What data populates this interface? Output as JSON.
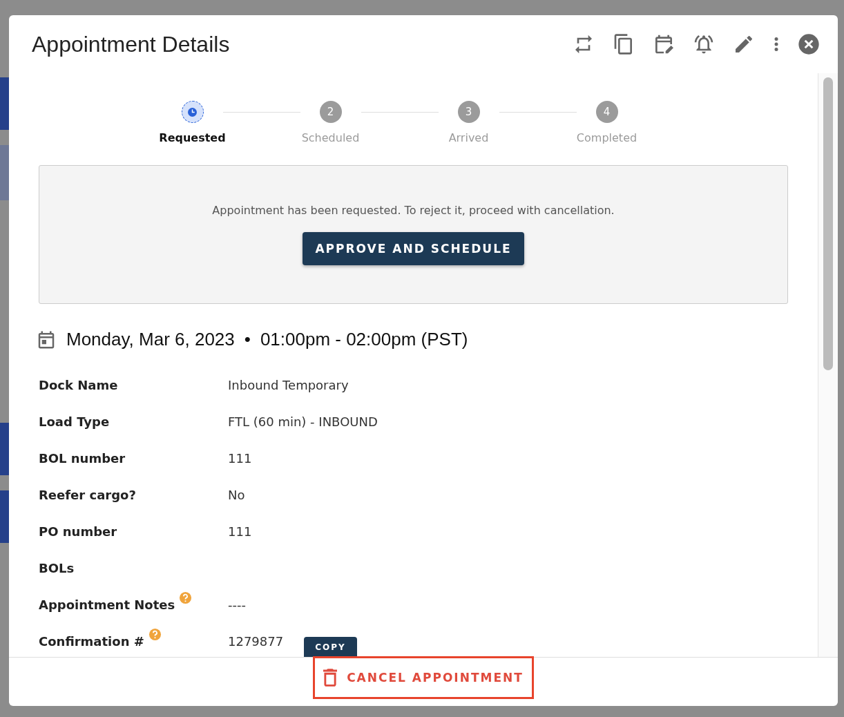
{
  "dialog": {
    "title": "Appointment Details"
  },
  "steps": [
    {
      "label": "Requested",
      "selected": true
    },
    {
      "number": "2",
      "label": "Scheduled",
      "selected": false
    },
    {
      "number": "3",
      "label": "Arrived",
      "selected": false
    },
    {
      "number": "4",
      "label": "Completed",
      "selected": false
    }
  ],
  "notice": {
    "message": "Appointment has been requested. To reject it, proceed with cancellation.",
    "button": "APPROVE AND SCHEDULE"
  },
  "schedule": {
    "date": "Monday, Mar 6, 2023",
    "separator": "•",
    "time": "01:00pm - 02:00pm (PST)"
  },
  "fields": [
    {
      "label": "Dock Name",
      "value": "Inbound Temporary",
      "help": false
    },
    {
      "label": "Load Type",
      "value": "FTL (60 min) - INBOUND",
      "help": false
    },
    {
      "label": "BOL number",
      "value": "111",
      "help": false
    },
    {
      "label": "Reefer cargo?",
      "value": "No",
      "help": false
    },
    {
      "label": "PO number",
      "value": "111",
      "help": false
    },
    {
      "label": "BOLs",
      "help": false
    },
    {
      "label": "Appointment Notes",
      "value": "----",
      "help": true
    },
    {
      "label": "Confirmation #",
      "value": "1279877",
      "help": true,
      "action": "COPY"
    }
  ],
  "footer": {
    "cancel_button": "CANCEL APPOINTMENT"
  }
}
